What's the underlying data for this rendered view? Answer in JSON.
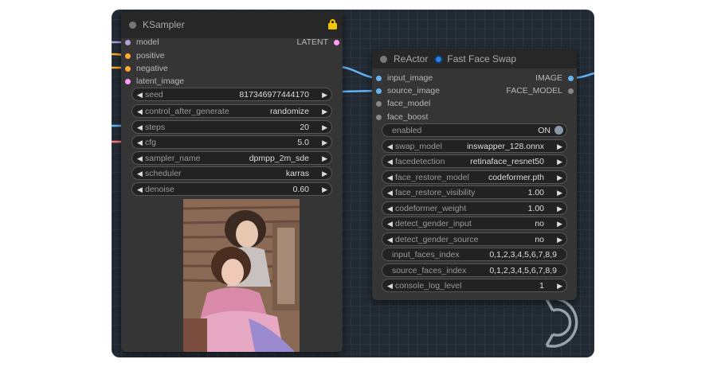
{
  "ksampler": {
    "title": "KSampler",
    "inputs": [
      {
        "label": "model",
        "color": "#b39ddb"
      },
      {
        "label": "positive",
        "color": "#ffa931"
      },
      {
        "label": "negative",
        "color": "#ffa931"
      },
      {
        "label": "latent_image",
        "color": "#ff9cf9"
      }
    ],
    "output": {
      "label": "LATENT",
      "color": "#ff9cf9"
    },
    "widgets": [
      {
        "label": "seed",
        "value": "817346977444170"
      },
      {
        "label": "control_after_generate",
        "value": "randomize"
      },
      {
        "label": "steps",
        "value": "20"
      },
      {
        "label": "cfg",
        "value": "5.0"
      },
      {
        "label": "sampler_name",
        "value": "dpmpp_2m_sde"
      },
      {
        "label": "scheduler",
        "value": "karras"
      },
      {
        "label": "denoise",
        "value": "0.60"
      }
    ]
  },
  "reactor": {
    "title_prefix": "ReActor",
    "title_suffix": "Fast Face Swap",
    "inputs": [
      {
        "label": "input_image",
        "color": "#64b5f6"
      },
      {
        "label": "source_image",
        "color": "#64b5f6"
      },
      {
        "label": "face_model",
        "color": "#888888"
      },
      {
        "label": "face_boost",
        "color": "#888888"
      }
    ],
    "outputs": [
      {
        "label": "IMAGE",
        "color": "#64b5f6"
      },
      {
        "label": "FACE_MODEL",
        "color": "#888888"
      }
    ],
    "toggle": {
      "label": "enabled",
      "value": "ON"
    },
    "widgets": [
      {
        "label": "swap_model",
        "value": "inswapper_128.onnx"
      },
      {
        "label": "facedetection",
        "value": "retinaface_resnet50"
      },
      {
        "label": "face_restore_model",
        "value": "codeformer.pth"
      },
      {
        "label": "face_restore_visibility",
        "value": "1.00"
      },
      {
        "label": "codeformer_weight",
        "value": "1.00"
      },
      {
        "label": "detect_gender_input",
        "value": "no"
      },
      {
        "label": "detect_gender_source",
        "value": "no"
      }
    ],
    "text_widgets": [
      {
        "label": "input_faces_index",
        "value": "0,1,2,3,4,5,6,7,8,9"
      },
      {
        "label": "source_faces_index",
        "value": "0,1,2,3,4,5,6,7,8,9"
      }
    ],
    "last_widget": {
      "label": "console_log_level",
      "value": "1"
    }
  },
  "icons": {
    "left_arrow": "◀",
    "right_arrow": "▶",
    "lock": "lock-icon",
    "reactor_badge": "reactor-badge-icon"
  }
}
